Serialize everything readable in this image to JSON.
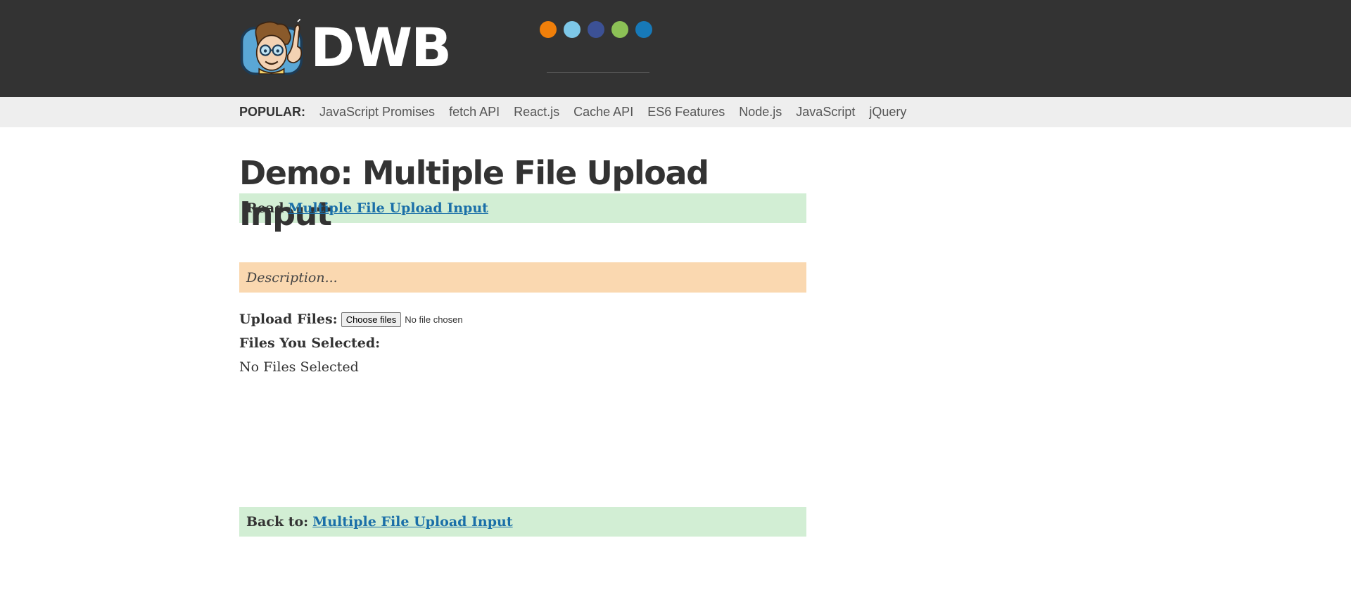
{
  "header": {
    "logo_text": "DWB",
    "mascot_icon": "david-walsh-mascot-icon",
    "dots": [
      {
        "name": "orange-dot",
        "color": "#f07f0a"
      },
      {
        "name": "light-blue-dot",
        "color": "#7ec8e8"
      },
      {
        "name": "navy-dot",
        "color": "#3c5195"
      },
      {
        "name": "green-dot",
        "color": "#8cc156"
      },
      {
        "name": "blue-dot",
        "color": "#1779b8"
      }
    ]
  },
  "popular": {
    "label": "POPULAR:",
    "links": [
      "JavaScript Promises",
      "fetch API",
      "React.js",
      "Cache API",
      "ES6 Features",
      "Node.js",
      "JavaScript",
      "jQuery"
    ]
  },
  "main": {
    "title": "Demo: Multiple File Upload Input",
    "read_prefix": "Read",
    "read_link": "Multiple File Upload Input",
    "description": "Description...",
    "upload_label": "Upload Files:",
    "choose_button": "Choose files",
    "file_status": "No file chosen",
    "selected_label": "Files You Selected:",
    "selected_value": "No Files Selected",
    "back_prefix": "Back to:",
    "back_link": "Multiple File Upload Input"
  },
  "colors": {
    "header_bg": "#333333",
    "popular_bg": "#eeeeee",
    "notice_green": "#d2eed4",
    "notice_orange": "#fad8b0",
    "link": "#1a6fa8"
  }
}
